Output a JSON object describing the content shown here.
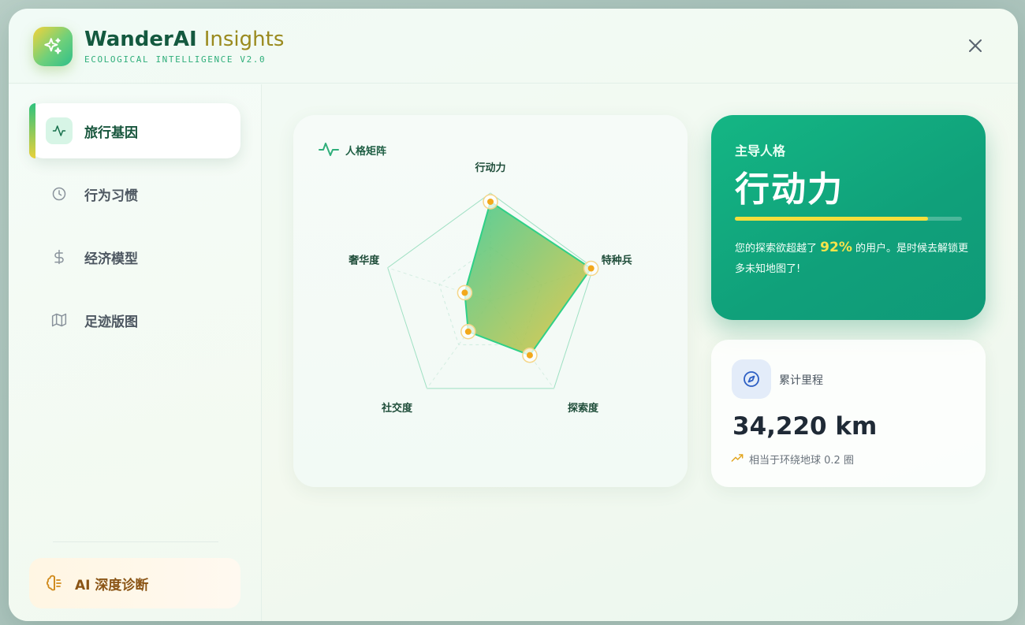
{
  "app": {
    "name": "WanderAI",
    "name_accent": "Insights",
    "subtitle": "ECOLOGICAL INTELLIGENCE V2.0"
  },
  "sidebar": {
    "items": [
      {
        "label": "旅行基因",
        "icon": "activity-icon",
        "active": true
      },
      {
        "label": "行为习惯",
        "icon": "clock-icon",
        "active": false
      },
      {
        "label": "经济模型",
        "icon": "dollar-icon",
        "active": false
      },
      {
        "label": "足迹版图",
        "icon": "map-icon",
        "active": false
      }
    ],
    "ai_button": {
      "label": "AI 深度诊断",
      "icon": "brain-icon"
    }
  },
  "radar": {
    "title": "人格矩阵",
    "chart_data": {
      "type": "radar",
      "axes": [
        "行动力",
        "特种兵",
        "探索度",
        "社交度",
        "奢华度"
      ],
      "values": [
        0.92,
        0.98,
        0.62,
        0.35,
        0.25
      ],
      "range": [
        0,
        1
      ],
      "grid_levels": 2
    }
  },
  "persona": {
    "label": "主导人格",
    "value": "行动力",
    "progress": 0.85,
    "desc_before": "您的探索欲超越了",
    "percent": "92%",
    "desc_after": "的用户。是时候去解锁更多未知地图了!"
  },
  "mileage": {
    "label": "累计里程",
    "value": "34,220 km",
    "note": "相当于环绕地球 0.2 圈"
  },
  "colors": {
    "brand_green": "#14b684",
    "accent_yellow": "#f5df3c",
    "dark_text": "#1f2a36"
  }
}
